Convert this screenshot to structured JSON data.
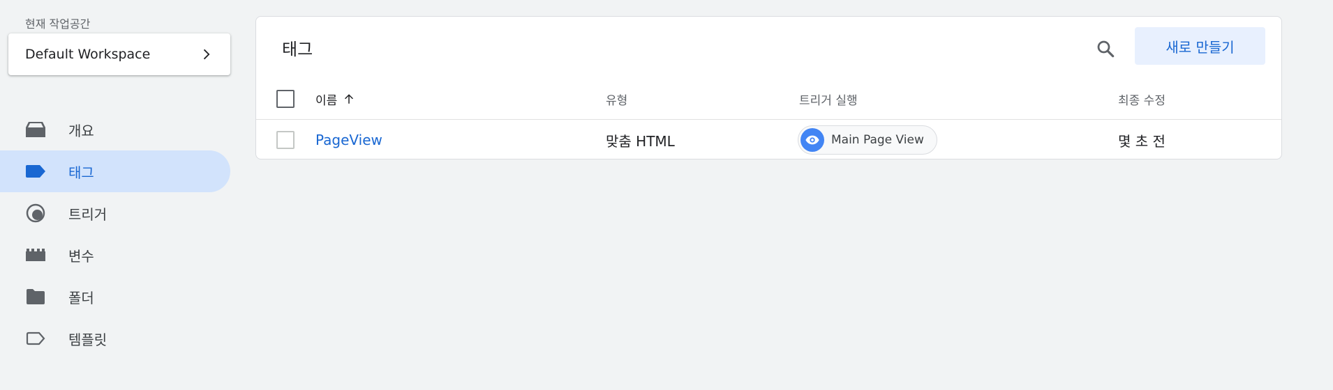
{
  "sidebar": {
    "workspace_caption": "현재 작업공간",
    "workspace_name": "Default Workspace",
    "items": [
      {
        "label": "개요",
        "icon": "inbox-icon"
      },
      {
        "label": "태그",
        "icon": "tag-icon",
        "active": true
      },
      {
        "label": "트리거",
        "icon": "trigger-icon"
      },
      {
        "label": "변수",
        "icon": "variable-icon"
      },
      {
        "label": "폴더",
        "icon": "folder-icon"
      },
      {
        "label": "템플릿",
        "icon": "template-icon"
      }
    ]
  },
  "panel": {
    "title": "태그",
    "create_label": "새로 만들기",
    "columns": [
      "이름",
      "유형",
      "트리거 실행",
      "최종 수정"
    ],
    "rows": [
      {
        "name": "PageView",
        "type": "맞춤 HTML",
        "trigger": "Main Page View",
        "modified": "몇 초 전"
      }
    ]
  },
  "colors": {
    "accent": "#1967d2",
    "active_bg": "#d2e3fc",
    "button_bg": "#e8f0fe",
    "chip_icon_bg": "#4285f4",
    "page_bg": "#f1f3f4"
  }
}
